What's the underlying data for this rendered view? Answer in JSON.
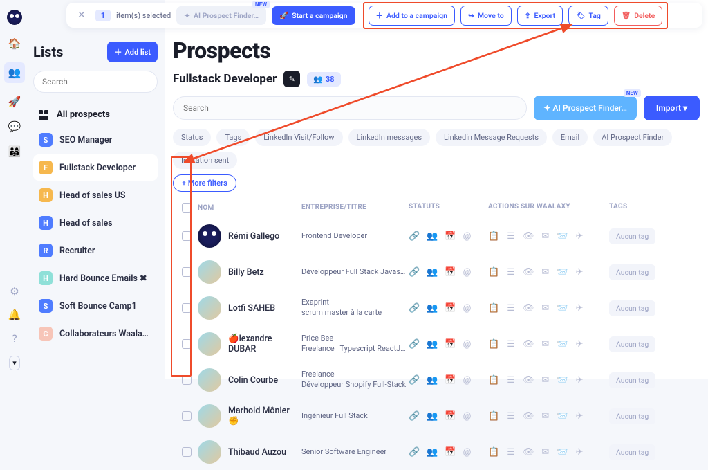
{
  "nav": {
    "icons": [
      "home",
      "users",
      "rocket",
      "chat",
      "group"
    ],
    "bottom": [
      "gear",
      "bell",
      "help"
    ]
  },
  "sidebar": {
    "title": "Lists",
    "add_list": "Add list",
    "search_placeholder": "Search",
    "all_prospects": "All prospects",
    "lists": [
      {
        "letter": "S",
        "color": "#4f7cff",
        "label": "SEO Manager"
      },
      {
        "letter": "F",
        "color": "#f6b84e",
        "label": "Fullstack Developer",
        "active": true
      },
      {
        "letter": "H",
        "color": "#f6b84e",
        "label": "Head of sales US"
      },
      {
        "letter": "H",
        "color": "#4f7cff",
        "label": "Head of sales"
      },
      {
        "letter": "R",
        "color": "#4f7cff",
        "label": "Recruiter"
      },
      {
        "letter": "H",
        "color": "#8fe0d8",
        "label": "Hard Bounce Emails ✖",
        "danger": true
      },
      {
        "letter": "S",
        "color": "#4f7cff",
        "label": "Soft Bounce Camp1"
      },
      {
        "letter": "C",
        "color": "#f7c5b8",
        "label": "Collaborateurs Waala…"
      }
    ]
  },
  "topbar": {
    "count": "1",
    "selected_text": "item(s) selected",
    "ai": "AI Prospect Finder…",
    "new": "NEW",
    "start": "Start a campaign",
    "add": "Add to a campaign",
    "move": "Move to",
    "export": "Export",
    "tag": "Tag",
    "delete": "Delete"
  },
  "page": {
    "title": "Prospects",
    "list_name": "Fullstack Developer",
    "count": "38",
    "search_placeholder": "Search",
    "ai_finder": "AI Prospect Finder…",
    "new": "NEW",
    "import": "Import"
  },
  "filters": [
    "Status",
    "Tags",
    "LinkedIn Visit/Follow",
    "LinkedIn messages",
    "Linkedin Message Requests",
    "Email",
    "AI Prospect Finder",
    "Invitation sent"
  ],
  "more_filters": "+  More filters",
  "columns": {
    "nom": "NOM",
    "ent": "ENTREPRISE/TITRE",
    "stat": "STATUTS",
    "act": "ACTIONS SUR WAALAXY",
    "tag": "TAGS"
  },
  "no_tag": "Aucun tag",
  "status_icons": [
    "link",
    "group",
    "calendar",
    "at"
  ],
  "action_icons": [
    "note",
    "rss",
    "eye",
    "envelope",
    "mail-open",
    "send"
  ],
  "rows": [
    {
      "name": "Rémi Gallego",
      "line1": "Frontend Developer",
      "line2": "",
      "av": "av0"
    },
    {
      "name": "Billy Betz",
      "line1": "Développeur Full Stack Javas…",
      "line2": ""
    },
    {
      "name": "Lotfi SAHEB",
      "line1": "Exaprint",
      "line2": "scrum master à la carte"
    },
    {
      "name": "🍎lexandre DUBAR",
      "line1": "Price Bee",
      "line2": "Freelance | Typescript ReactJ…"
    },
    {
      "name": "Colin Courbe",
      "line1": "Freelance",
      "line2": "Développeur Shopify Full-Stack"
    },
    {
      "name": "Marhold Mônier ✊",
      "line1": "Ingénieur Full Stack",
      "line2": ""
    },
    {
      "name": "Thibaud Auzou",
      "line1": "Senior Software Engineer",
      "line2": ""
    }
  ]
}
